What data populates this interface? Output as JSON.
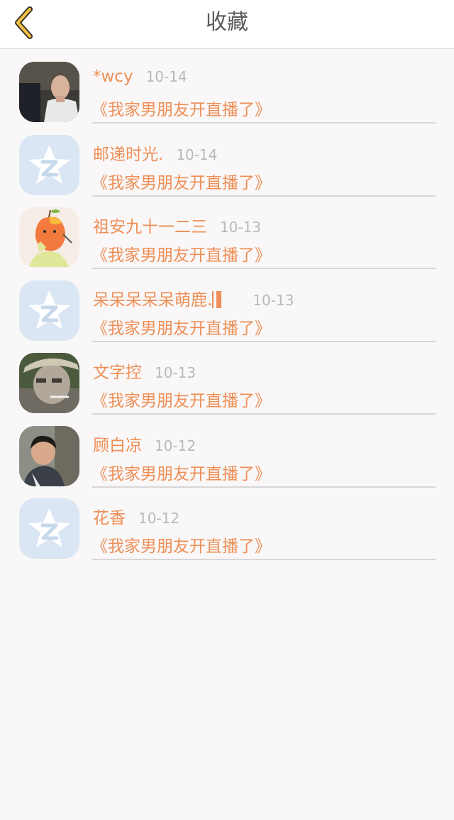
{
  "header": {
    "title": "收藏",
    "back_icon": "chevron-left-icon",
    "accent_color": "#f5c242"
  },
  "favorites": [
    {
      "name": "*wcy",
      "date": "10-14",
      "title": "《我家男朋友开直播了》",
      "avatar": "photo-young-man"
    },
    {
      "name": "邮递时光.",
      "date": "10-14",
      "title": "《我家男朋友开直播了》",
      "avatar": "default-qq-star"
    },
    {
      "name": "祖安九十一二三",
      "date": "10-13",
      "title": "《我家男朋友开直播了》",
      "avatar": "cartoon-apple"
    },
    {
      "name": "呆呆呆呆呆萌鹿.",
      "date": "10-13",
      "title": "《我家男朋友开直播了》",
      "avatar": "default-qq-star"
    },
    {
      "name": "文字控",
      "date": "10-13",
      "title": "《我家男朋友开直播了》",
      "avatar": "photo-man-hat"
    },
    {
      "name": "顾白凉",
      "date": "10-12",
      "title": "《我家男朋友开直播了》",
      "avatar": "photo-boy"
    },
    {
      "name": "花香",
      "date": "10-12",
      "title": "《我家男朋友开直播了》",
      "avatar": "default-qq-star"
    }
  ],
  "colors": {
    "name_text": "#ee8f57",
    "date_text": "#b9b9b9",
    "background": "#f9f7f7"
  }
}
